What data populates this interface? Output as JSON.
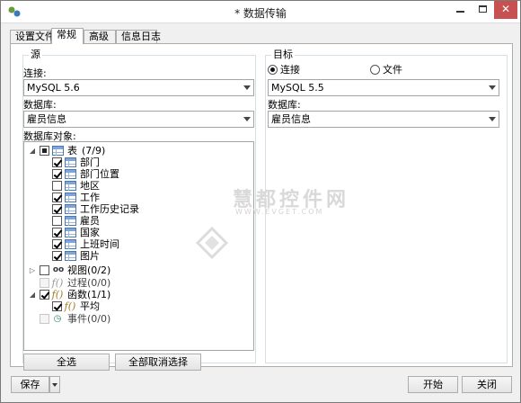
{
  "window": {
    "title": "* 数据传输",
    "close_glyph": "✕"
  },
  "tabs": [
    {
      "label": "设置文件",
      "active": false
    },
    {
      "label": "常规",
      "active": true
    },
    {
      "label": "高级",
      "active": false
    },
    {
      "label": "信息日志",
      "active": false
    }
  ],
  "source": {
    "group_title": "源",
    "connection_label": "连接:",
    "connection_value": "MySQL 5.6",
    "database_label": "数据库:",
    "database_value": "雇员信息",
    "objects_label": "数据库对象:",
    "tree": [
      {
        "label": "表",
        "count": "(7/9)",
        "expander": "◢",
        "state": "partial",
        "icon": "table-icon",
        "level": 0
      },
      {
        "label": "部门",
        "state": "checked",
        "icon": "table-icon",
        "level": 1
      },
      {
        "label": "部门位置",
        "state": "checked",
        "icon": "table-icon",
        "level": 1
      },
      {
        "label": "地区",
        "state": "unchecked",
        "icon": "table-icon",
        "level": 1
      },
      {
        "label": "工作",
        "state": "checked",
        "icon": "table-icon",
        "level": 1
      },
      {
        "label": "工作历史记录",
        "state": "checked",
        "icon": "table-icon",
        "level": 1
      },
      {
        "label": "雇员",
        "state": "unchecked",
        "icon": "table-icon",
        "level": 1
      },
      {
        "label": "国家",
        "state": "checked",
        "icon": "table-icon",
        "level": 1
      },
      {
        "label": "上班时间",
        "state": "checked",
        "icon": "table-icon",
        "level": 1
      },
      {
        "label": "图片",
        "state": "checked",
        "icon": "table-icon",
        "level": 1
      },
      {
        "label": "视图",
        "count": "(0/2)",
        "expander": "▷",
        "state": "unchecked",
        "icon": "view-icon",
        "level": 0
      },
      {
        "label": "过程",
        "count": "(0/0)",
        "state": "disabled",
        "icon": "procedure-icon",
        "level": 0
      },
      {
        "label": "函数",
        "count": "(1/1)",
        "expander": "◢",
        "state": "checked",
        "icon": "function-icon",
        "level": 0
      },
      {
        "label": "平均",
        "state": "checked",
        "icon": "function-icon",
        "level": 1
      },
      {
        "label": "事件",
        "count": "(0/0)",
        "state": "disabled",
        "icon": "event-icon",
        "level": 0
      }
    ],
    "select_all_label": "全选",
    "deselect_all_label": "全部取消选择"
  },
  "target": {
    "group_title": "目标",
    "radio_connection_label": "连接",
    "radio_file_label": "文件",
    "connection_value": "MySQL 5.5",
    "database_label": "数据库:",
    "database_value": "雇员信息"
  },
  "footer": {
    "save_label": "保存",
    "start_label": "开始",
    "close_label": "关闭"
  },
  "watermark": {
    "text": "慧都控件网",
    "sub": "WWW.EVGET.COM"
  },
  "colors": {
    "close_button": "#c75050",
    "group_border": "#d5dfe5",
    "table_icon": "#4a78b0"
  }
}
